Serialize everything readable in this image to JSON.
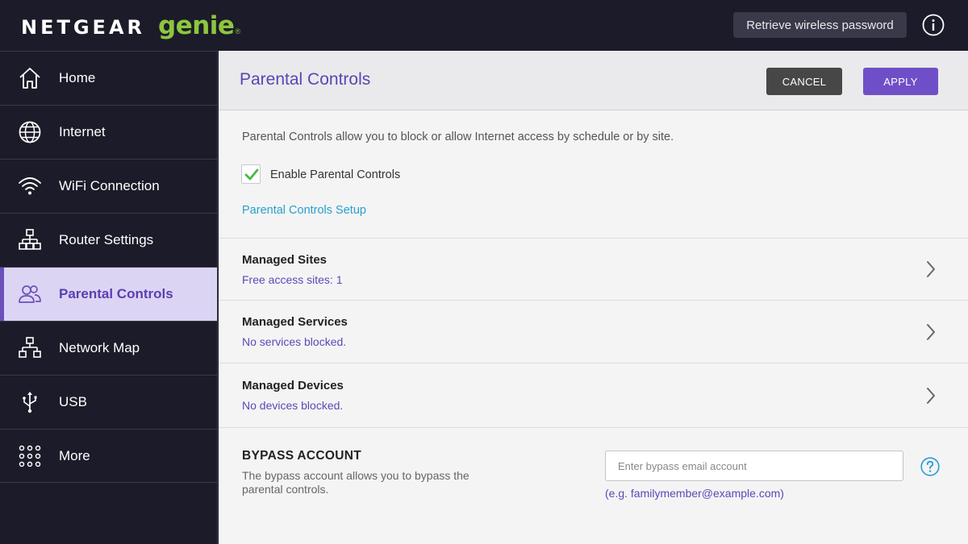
{
  "brand": {
    "name": "NETGEAR",
    "product": "genie",
    "mark": "®"
  },
  "topbar": {
    "retrieve_label": "Retrieve wireless password",
    "info_icon": "info-icon"
  },
  "sidebar": {
    "items": [
      {
        "label": "Home",
        "icon": "home-icon"
      },
      {
        "label": "Internet",
        "icon": "globe-icon"
      },
      {
        "label": "WiFi Connection",
        "icon": "wifi-icon"
      },
      {
        "label": "Router Settings",
        "icon": "router-settings-icon"
      },
      {
        "label": "Parental Controls",
        "icon": "users-icon",
        "active": true
      },
      {
        "label": "Network Map",
        "icon": "network-map-icon"
      },
      {
        "label": "USB",
        "icon": "usb-icon"
      },
      {
        "label": "More",
        "icon": "grid-dots-icon"
      }
    ]
  },
  "main": {
    "title": "Parental Controls",
    "cancel_label": "CANCEL",
    "apply_label": "APPLY",
    "intro": "Parental Controls allow you to block or allow Internet access by schedule or by site.",
    "enable_label": "Enable Parental Controls",
    "enable_checked": true,
    "setup_link": "Parental Controls Setup",
    "sections": [
      {
        "title": "Managed Sites",
        "subtitle": "Free access sites: 1"
      },
      {
        "title": "Managed Services",
        "subtitle": "No services blocked."
      },
      {
        "title": "Managed Devices",
        "subtitle": "No devices blocked."
      }
    ],
    "bypass": {
      "title": "BYPASS ACCOUNT",
      "description": "The bypass account allows you to bypass the parental controls.",
      "input_placeholder": "Enter bypass email account",
      "input_value": "",
      "example": "(e.g. familymember@example.com)"
    }
  },
  "colors": {
    "brand_green": "#8dc63f",
    "accent_purple": "#6f4fc8",
    "dark_bg": "#1c1b29",
    "link_blue": "#2aa0c8"
  }
}
